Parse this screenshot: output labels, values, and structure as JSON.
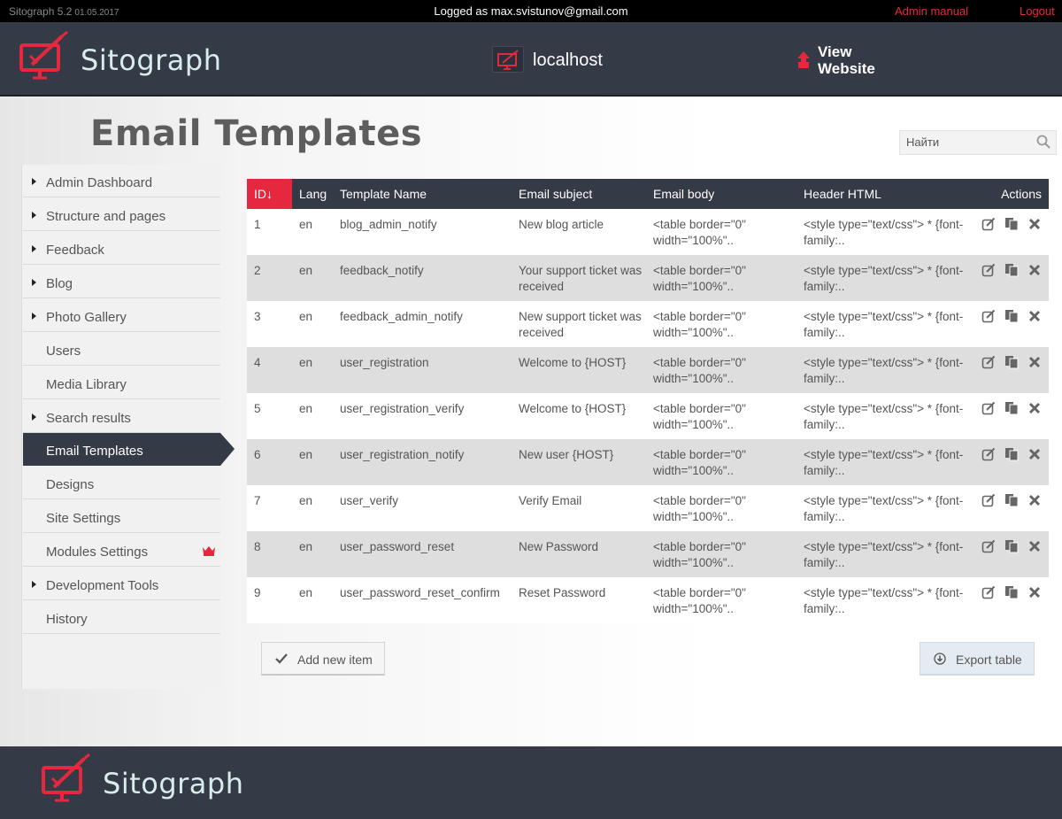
{
  "topbar": {
    "version": "Sitograph 5.2",
    "date": "01.05.2017",
    "logged_as": "Logged as max.svistunov@gmail.com",
    "admin_manual": "Admin manual",
    "logout": "Logout"
  },
  "header": {
    "brand": "Sitograph",
    "host": "localhost",
    "view_website": "View Website"
  },
  "page": {
    "title": "Email Templates"
  },
  "search": {
    "placeholder": "Найти"
  },
  "sidebar": {
    "items": [
      {
        "label": "Admin Dashboard",
        "has_arrow": true
      },
      {
        "label": "Structure and pages",
        "has_arrow": true
      },
      {
        "label": "Feedback",
        "has_arrow": true
      },
      {
        "label": "Blog",
        "has_arrow": true
      },
      {
        "label": "Photo Gallery",
        "has_arrow": true
      },
      {
        "label": "Users",
        "has_arrow": false
      },
      {
        "label": "Media Library",
        "has_arrow": false
      },
      {
        "label": "Search results",
        "has_arrow": true
      },
      {
        "label": "Email Templates",
        "has_arrow": false,
        "active": true
      },
      {
        "label": "Designs",
        "has_arrow": false
      },
      {
        "label": "Site Settings",
        "has_arrow": false
      },
      {
        "label": "Modules Settings",
        "has_arrow": false,
        "badge": "crown-icon"
      },
      {
        "label": "Development Tools",
        "has_arrow": true
      },
      {
        "label": "History",
        "has_arrow": false
      }
    ]
  },
  "table": {
    "columns": [
      "ID↓",
      "Lang",
      "Template Name",
      "Email subject",
      "Email body",
      "Header HTML",
      "Actions"
    ],
    "rows": [
      [
        "1",
        "en",
        "blog_admin_notify",
        "New blog article",
        "<table border=\"0\" width=\"100%\"..",
        "<style type=\"text/css\"> * {font-family:.."
      ],
      [
        "2",
        "en",
        "feedback_notify",
        "Your support ticket was received",
        "<table border=\"0\" width=\"100%\"..",
        "<style type=\"text/css\"> * {font-family:.."
      ],
      [
        "3",
        "en",
        "feedback_admin_notify",
        "New support ticket was received",
        "<table border=\"0\" width=\"100%\"..",
        "<style type=\"text/css\"> * {font-family:.."
      ],
      [
        "4",
        "en",
        "user_registration",
        "Welcome to {HOST}",
        "<table border=\"0\" width=\"100%\"..",
        "<style type=\"text/css\"> * {font-family:.."
      ],
      [
        "5",
        "en",
        "user_registration_verify",
        "Welcome to {HOST}",
        "<table border=\"0\" width=\"100%\"..",
        "<style type=\"text/css\"> * {font-family:.."
      ],
      [
        "6",
        "en",
        "user_registration_notify",
        "New user {HOST}",
        "<table border=\"0\" width=\"100%\"..",
        "<style type=\"text/css\"> * {font-family:.."
      ],
      [
        "7",
        "en",
        "user_verify",
        "Verify Email",
        "<table border=\"0\" width=\"100%\"..",
        "<style type=\"text/css\"> * {font-family:.."
      ],
      [
        "8",
        "en",
        "user_password_reset",
        "New Password",
        "<table border=\"0\" width=\"100%\"..",
        "<style type=\"text/css\"> * {font-family:.."
      ],
      [
        "9",
        "en",
        "user_password_reset_confirm",
        "Reset Password",
        "<table border=\"0\" width=\"100%\"..",
        "<style type=\"text/css\"> * {font-family:.."
      ]
    ],
    "row_actions": [
      "edit-icon",
      "copy-icon",
      "delete-icon"
    ]
  },
  "buttons": {
    "add": "Add new item",
    "export": "Export table"
  },
  "footer": {
    "brand": "Sitograph"
  },
  "colors": {
    "accent": "#e6283e",
    "dark": "#353a47",
    "row_alt": "#dedede"
  }
}
